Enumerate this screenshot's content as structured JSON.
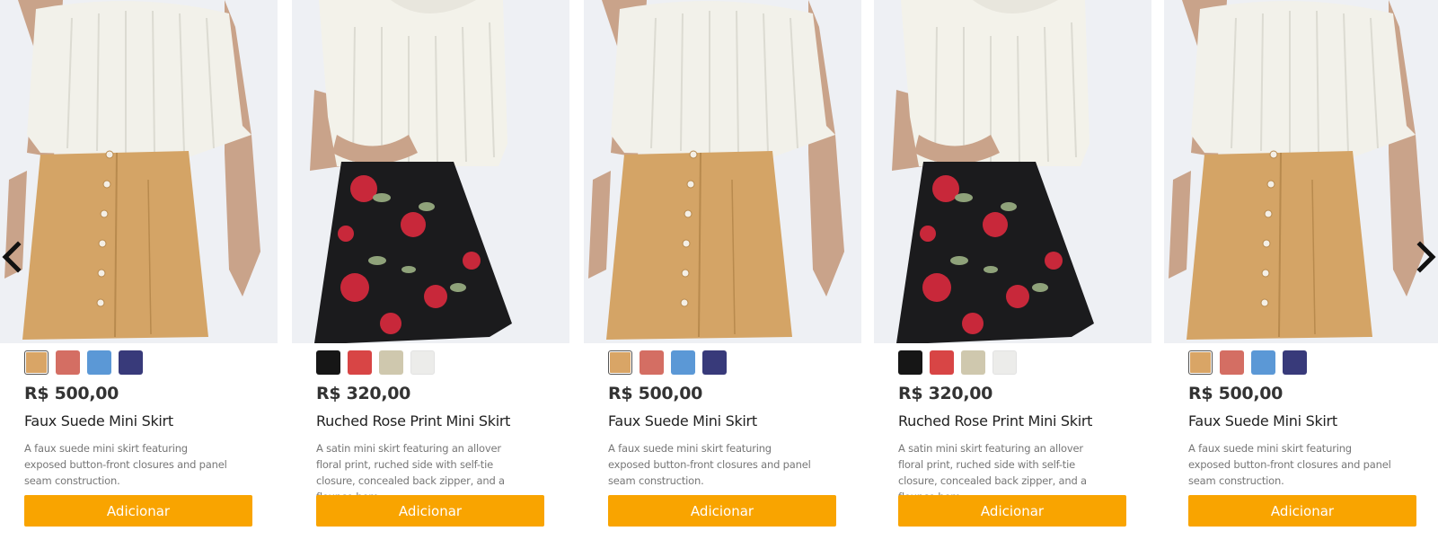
{
  "carousel": {
    "prev_icon": "chevron-left-icon",
    "next_icon": "chevron-right-icon",
    "products": [
      {
        "image": "faux-suede-skirt",
        "colors": [
          "#D9A566",
          "#D46E63",
          "#5B98D6",
          "#383A7A"
        ],
        "selected_color": 0,
        "price": "R$ 500,00",
        "name": "Faux Suede Mini Skirt",
        "description": "A faux suede mini skirt featuring exposed button-front closures and panel seam construction.",
        "button_label": "Adicionar"
      },
      {
        "image": "rose-print-skirt",
        "colors": [
          "#161616",
          "#D84545",
          "#CFC8AE",
          "#ECECEA"
        ],
        "selected_color": -1,
        "price": "R$ 320,00",
        "name": "Ruched Rose Print Mini Skirt",
        "description": "A satin mini skirt featuring an allover floral print, ruched side with self-tie closure, concealed back zipper, and a flounce hem.",
        "button_label": "Adicionar"
      },
      {
        "image": "faux-suede-skirt",
        "colors": [
          "#D9A566",
          "#D46E63",
          "#5B98D6",
          "#383A7A"
        ],
        "selected_color": 0,
        "price": "R$ 500,00",
        "name": "Faux Suede Mini Skirt",
        "description": "A faux suede mini skirt featuring exposed button-front closures and panel seam construction.",
        "button_label": "Adicionar"
      },
      {
        "image": "rose-print-skirt",
        "colors": [
          "#161616",
          "#D84545",
          "#CFC8AE",
          "#ECECEA"
        ],
        "selected_color": -1,
        "price": "R$ 320,00",
        "name": "Ruched Rose Print Mini Skirt",
        "description": "A satin mini skirt featuring an allover floral print, ruched side with self-tie closure, concealed back zipper, and a flounce hem.",
        "button_label": "Adicionar"
      },
      {
        "image": "faux-suede-skirt",
        "colors": [
          "#D9A566",
          "#D46E63",
          "#5B98D6",
          "#383A7A"
        ],
        "selected_color": 0,
        "price": "R$ 500,00",
        "name": "Faux Suede Mini Skirt",
        "description": "A faux suede mini skirt featuring exposed button-front closures and panel seam construction.",
        "button_label": "Adicionar"
      }
    ]
  },
  "theme": {
    "accent": "#F9A400",
    "price_color": "#333333",
    "text_muted": "#777777"
  }
}
